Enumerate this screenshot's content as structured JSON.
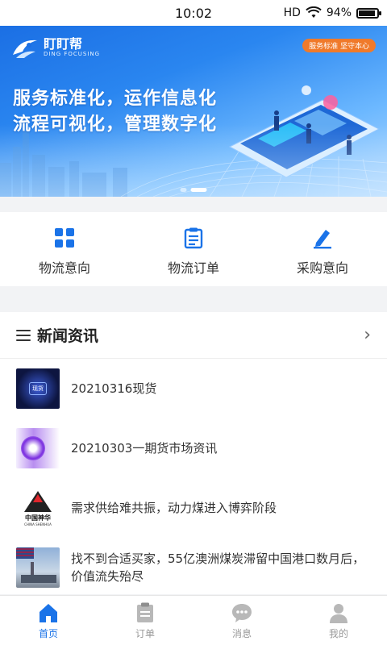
{
  "status_bar": {
    "time": "10:02",
    "network": "HD",
    "battery_percent": "94%",
    "battery_level": 0.94
  },
  "banner": {
    "logo_text": "盯盯帮",
    "logo_sub": "DING FOCUSING",
    "pill": "服务标准 坚守本心",
    "slogan_line1": "服务标准化，运作信息化",
    "slogan_line2": "流程可视化，管理数字化",
    "dots": 2,
    "active_dot": 1
  },
  "quick_actions": [
    {
      "label": "物流意向",
      "icon": "grid-icon"
    },
    {
      "label": "物流订单",
      "icon": "clipboard-icon"
    },
    {
      "label": "采购意向",
      "icon": "pen-icon"
    }
  ],
  "news": {
    "title": "新闻资讯",
    "items": [
      {
        "title": "20210316现货",
        "thumb_text": "现货"
      },
      {
        "title": "20210303一期货市场资讯"
      },
      {
        "title": "需求供给难共振，动力煤进入博弈阶段",
        "thumb_brand": "中国神华",
        "thumb_brand_en": "CHINA SHENHUA"
      },
      {
        "title": "找不到合适买家，55亿澳洲煤炭滞留中国港口数月后，价值流失殆尽"
      }
    ]
  },
  "tabbar": {
    "tabs": [
      {
        "label": "首页",
        "icon": "home-icon"
      },
      {
        "label": "订单",
        "icon": "order-icon"
      },
      {
        "label": "消息",
        "icon": "message-icon"
      },
      {
        "label": "我的",
        "icon": "user-icon"
      }
    ],
    "active_index": 0
  },
  "colors": {
    "accent": "#1a73e8",
    "inactive": "#b8b8b8",
    "pill": "#f07a2a"
  }
}
